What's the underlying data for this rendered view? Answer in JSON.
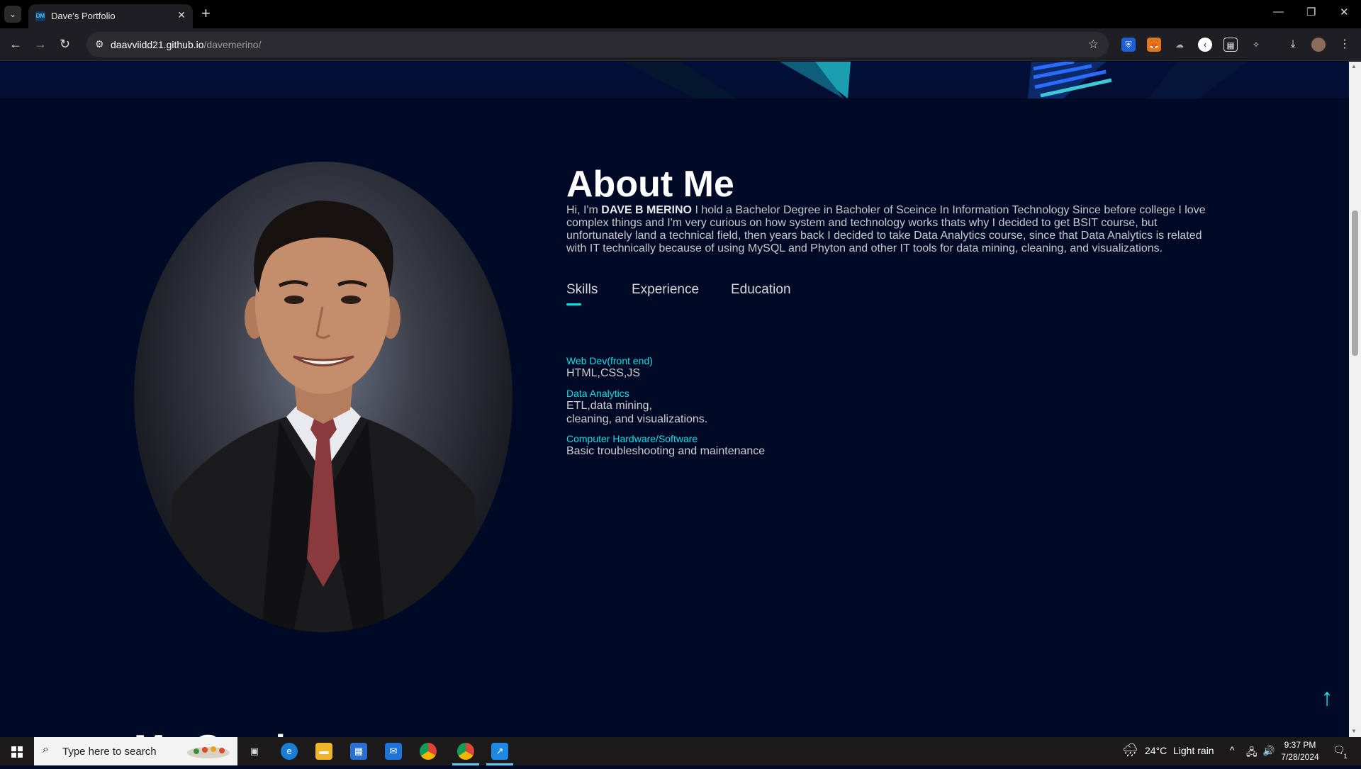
{
  "browser": {
    "tab_title": "Dave's Portfolio",
    "url_host": "daavviidd21.github.io",
    "url_path": "/davemerino/"
  },
  "about": {
    "title": "About Me",
    "intro_prefix": "Hi, I'm ",
    "name": "DAVE B MERINO",
    "intro_line1_rest": " I hold a Bachelor Degree in Bacholer of Sceince In Information Technology Since before college I love",
    "intro_line2": "complex things and I'm very curious on how system and technology works thats why I decided to get BSIT course, but",
    "intro_line3": "unfortunately land a technical field, then years back I decided to take Data Analytics course, since that Data Analytics is related",
    "intro_line4": "with IT technically because of using MySQL and Phyton and other IT tools for data mining, cleaning, and visualizations."
  },
  "tabs": [
    {
      "label": "Skills",
      "active": true
    },
    {
      "label": "Experience",
      "active": false
    },
    {
      "label": "Education",
      "active": false
    }
  ],
  "skills": [
    {
      "title": "Web Dev(front end)",
      "line1": "HTML,CSS,JS",
      "line2": ""
    },
    {
      "title": "Data Analytics",
      "line1": "ETL,data mining,",
      "line2": "cleaning, and visualizations."
    },
    {
      "title": "Computer Hardware/Software",
      "line1": "Basic troubleshooting and maintenance",
      "line2": ""
    }
  ],
  "next_section_heading": "My Services",
  "accent_color": "#00e5e5",
  "taskbar": {
    "search_placeholder": "Type here to search",
    "weather_temp": "24°C",
    "weather_desc": "Light rain",
    "time": "9:37 PM",
    "date": "7/28/2024",
    "notification_count": "1"
  }
}
